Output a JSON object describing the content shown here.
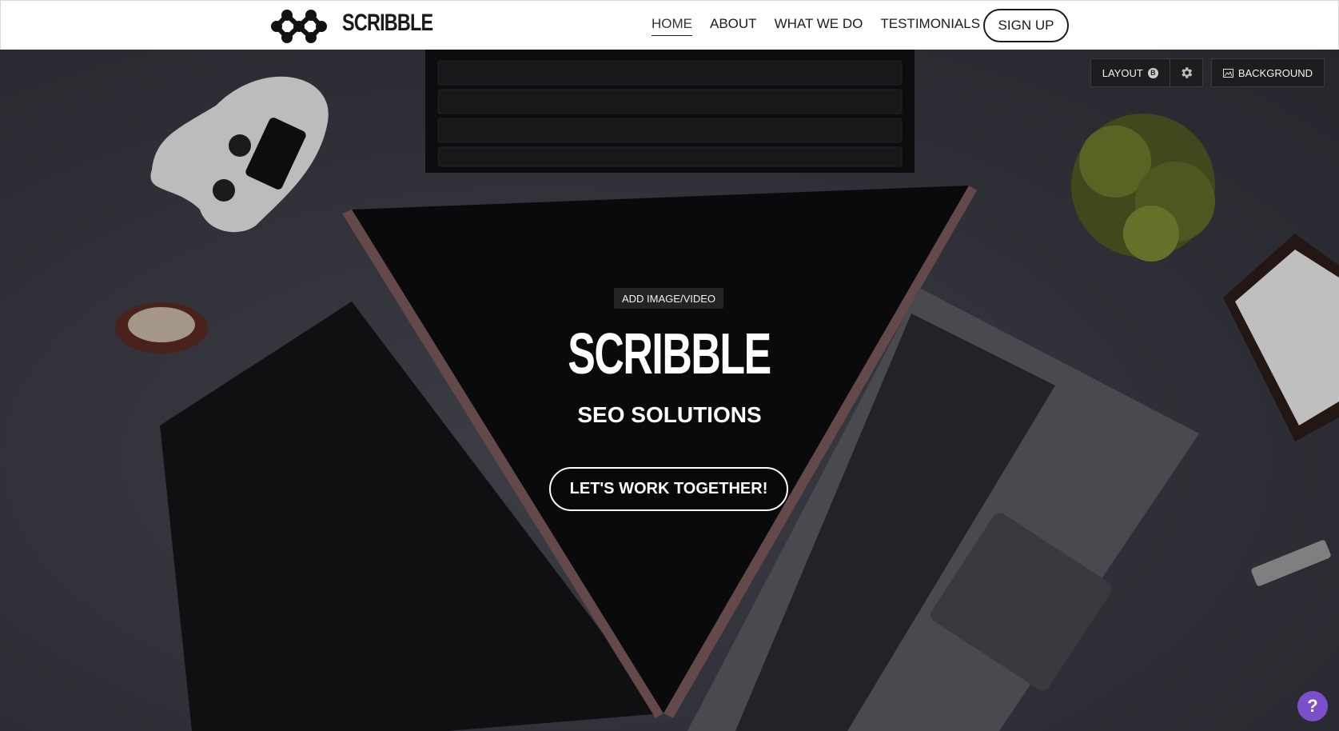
{
  "header": {
    "logo_text": "SCRIBBLE",
    "nav": [
      {
        "label": "HOME",
        "active": true
      },
      {
        "label": "ABOUT",
        "active": false
      },
      {
        "label": "WHAT WE DO",
        "active": false
      },
      {
        "label": "TESTIMONIALS",
        "active": false
      }
    ],
    "signup_label": "SIGN UP"
  },
  "editor_tools": {
    "layout_label": "LAYOUT",
    "layout_badge": "B",
    "background_label": "BACKGROUND"
  },
  "hero": {
    "add_media_label": "ADD IMAGE/VIDEO",
    "title": "SCRIBBLE",
    "subtitle": "SEO SOLUTIONS",
    "cta_label": "LET'S WORK TOGETHER!"
  },
  "help": {
    "label": "?",
    "color": "#7b4fc9"
  },
  "icons": [
    "scribble-logo-icon",
    "gear-icon",
    "image-icon",
    "help-icon"
  ]
}
